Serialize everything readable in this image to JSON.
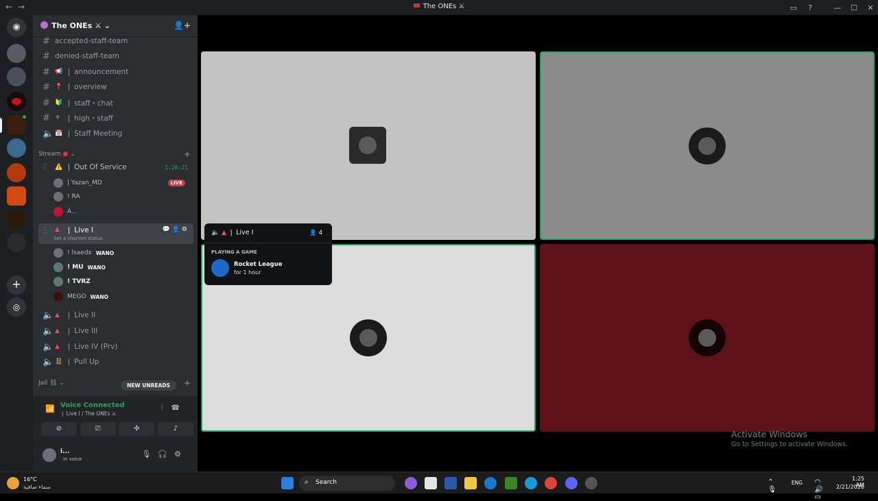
{
  "window": {
    "title": "The ONEs ⚔"
  },
  "guild": {
    "name": "The ONEs ⚔"
  },
  "text_channels": [
    {
      "name": "accepted-staff-team",
      "icon": "hash-icon"
    },
    {
      "name": "denied-staff-team",
      "icon": "hash-icon"
    },
    {
      "name": "❘ announcement",
      "icon": "hash-icon",
      "emoji": "📢"
    },
    {
      "name": "❘ overview",
      "icon": "hash-icon",
      "emoji": "📍"
    },
    {
      "name": "❘ staff・chat",
      "icon": "hash-icon",
      "emoji": "🔰"
    },
    {
      "name": "❘ high・staff",
      "icon": "hash-icon",
      "emoji": "⚜"
    },
    {
      "name": "❘ Staff Meeting",
      "icon": "speaker-icon",
      "emoji": "📅"
    }
  ],
  "categories": {
    "stream": "Stream",
    "jail": "Jail"
  },
  "voice_channels": {
    "out_of_service": {
      "name": "❘ Out Of Service",
      "timer": "1:20:21"
    },
    "live_1": {
      "name": "❘ Live I",
      "status_placeholder": "Set a channel status"
    },
    "others": [
      "❘ Live II",
      "❘ Live III",
      "❘ Live IV (Prv)",
      "❘ Pull Up"
    ]
  },
  "oos_users": [
    {
      "name": "| Yazan_MD",
      "badge": "LIVE"
    },
    {
      "name": "! RA"
    },
    {
      "name": "A..."
    }
  ],
  "live1_users": [
    {
      "name": "! lsaedx",
      "tag": "WANO"
    },
    {
      "name": "! MU",
      "tag": "WANO"
    },
    {
      "name": "! TVRZ"
    },
    {
      "name": "MEGO",
      "tag": "WANO"
    }
  ],
  "new_unreads": "NEW UNREADS",
  "voice_panel": {
    "status": "Voice Connected",
    "location": "❘ Live I / The ONEs ⚔"
  },
  "user_area": {
    "name": "i...",
    "status": "In voice"
  },
  "popup": {
    "channel": "❘ Live I",
    "count": "4",
    "section": "PLAYING A GAME",
    "game": "Rocket League",
    "duration": "for 1 hour"
  },
  "tiles": [
    {
      "bg": "#c2c2c2",
      "active": false
    },
    {
      "bg": "#8b8b8b",
      "active": true
    },
    {
      "bg": "#dcdcdc",
      "active": true
    },
    {
      "bg": "#5e1219",
      "active": false
    }
  ],
  "activate_windows": {
    "title": "Activate Windows",
    "subtitle": "Go to Settings to activate Windows."
  },
  "taskbar": {
    "weather_temp": "16°C",
    "weather_desc": "سماء صافية",
    "search": "Search",
    "lang": "ENG",
    "time": "1:25 AM",
    "date": "2/21/2026"
  }
}
